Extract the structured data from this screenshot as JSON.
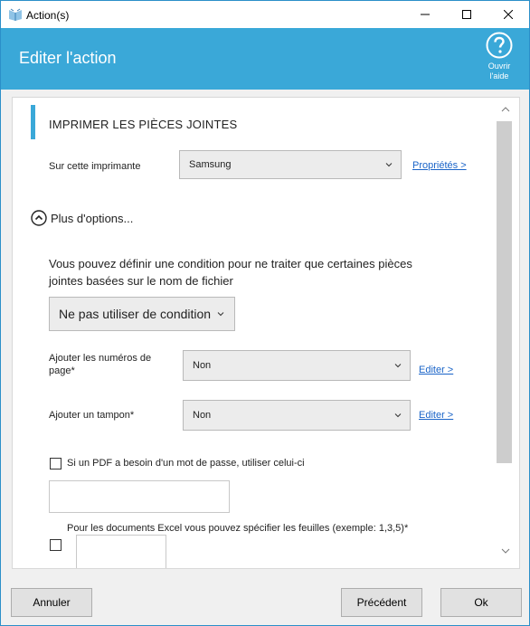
{
  "window": {
    "title": "Action(s)",
    "icon": "app-icon"
  },
  "header": {
    "title": "Editer l'action",
    "help_label_1": "Ouvrir",
    "help_label_2": "l'aide"
  },
  "section": {
    "title": "IMPRIMER LES PIÈCES JOINTES"
  },
  "printer": {
    "label": "Sur cette imprimante",
    "value": "Samsung",
    "link": "Propriétés >"
  },
  "more_options": {
    "label": "Plus d'options..."
  },
  "condition": {
    "description": "Vous pouvez définir une condition pour ne traiter que certaines pièces jointes basées sur le nom de fichier",
    "value": "Ne pas utiliser de condition"
  },
  "page_numbers": {
    "label_1": "Ajouter les numéros de",
    "label_2": "page*",
    "value": "Non",
    "link": "Editer >"
  },
  "stamp": {
    "label": "Ajouter un tampon*",
    "value": "Non",
    "link": "Editer >"
  },
  "pdf_password": {
    "label": "Si un PDF a besoin d'un mot de passe, utiliser celui-ci",
    "checked": false,
    "value": ""
  },
  "excel_sheets": {
    "label": "Pour les documents Excel vous pouvez spécifier les feuilles (exemple: 1,3,5)*",
    "checked": false,
    "value": ""
  },
  "footer": {
    "cancel": "Annuler",
    "previous": "Précédent",
    "ok": "Ok"
  },
  "colors": {
    "accent": "#3aa8d8",
    "link": "#1a64c8"
  }
}
